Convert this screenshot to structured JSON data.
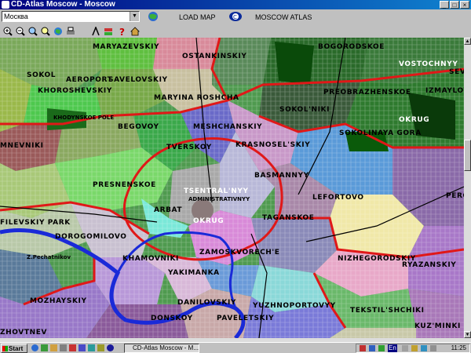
{
  "window": {
    "title": "CD-Atlas Moscow - Moscow",
    "buttons": [
      "_",
      "□",
      "×"
    ]
  },
  "toolbar": {
    "city_select": "Москва",
    "load_map": "LOAD MAP",
    "moscow_atlas": "MOSCOW ATLAS",
    "tools": [
      "zoom-in-icon",
      "zoom-out-icon",
      "search-icon",
      "find-icon",
      "globe-icon",
      "print-icon",
      "measure-icon",
      "layers-icon",
      "help-icon",
      "home-icon"
    ]
  },
  "map": {
    "districts": [
      "MARYAZEVSKIY",
      "OSTANKINSKIY",
      "BOGORODSKOE",
      "VOSTOCHNYY",
      "SOKOL",
      "AEROPORT",
      "SAVELOVSKIY",
      "SEV",
      "KHOROSHEVSKIY",
      "MARYINA ROSHCHA",
      "PREOBRAZHENSKOE",
      "IZMAYLOV",
      "SOKOL'NIKI",
      "KHODYNSKOE POLE",
      "OKRUG",
      "BEGOVOY",
      "MESHCHANSKIY",
      "SOKOLINAYA GORA",
      "MNEVNIKI",
      "TVERSKOY",
      "KRASNOSEL'SKIY",
      "PRESNENSKOE",
      "BASMANNYY",
      "TSENTRAL'NYY",
      "ADMINISTRATIVNYY",
      "PERO",
      "ARBAT",
      "LEFORTOVO",
      "FILEVSKIY PARK",
      "OKRUG",
      "TAGANSKOE",
      "DOROGOMILOVO",
      "KHAMOVNIKI",
      "ZAMOSKVORECH'E",
      "NIZHEGORODSKIY",
      "RYAZANSKIY",
      "YAKIMANKA",
      "MOZHAYSKIY",
      "DANILOVSKIY",
      "YUZHNOPORTOVYY",
      "DONSKOY",
      "PAVELETSKIY",
      "TEKSTIL'SHCHIKI",
      "KUZ'MINKI",
      "Z.Pechatnikov",
      "ZHOVTNEV"
    ]
  },
  "taskbar": {
    "start": "Start",
    "task": "CD-Atlas Moscow - M...",
    "tray_lang": "En",
    "clock": "11:25"
  },
  "colors": {
    "title_bar": "#000080",
    "okrug_border": "#e01818",
    "river": "#1a2ad8"
  }
}
